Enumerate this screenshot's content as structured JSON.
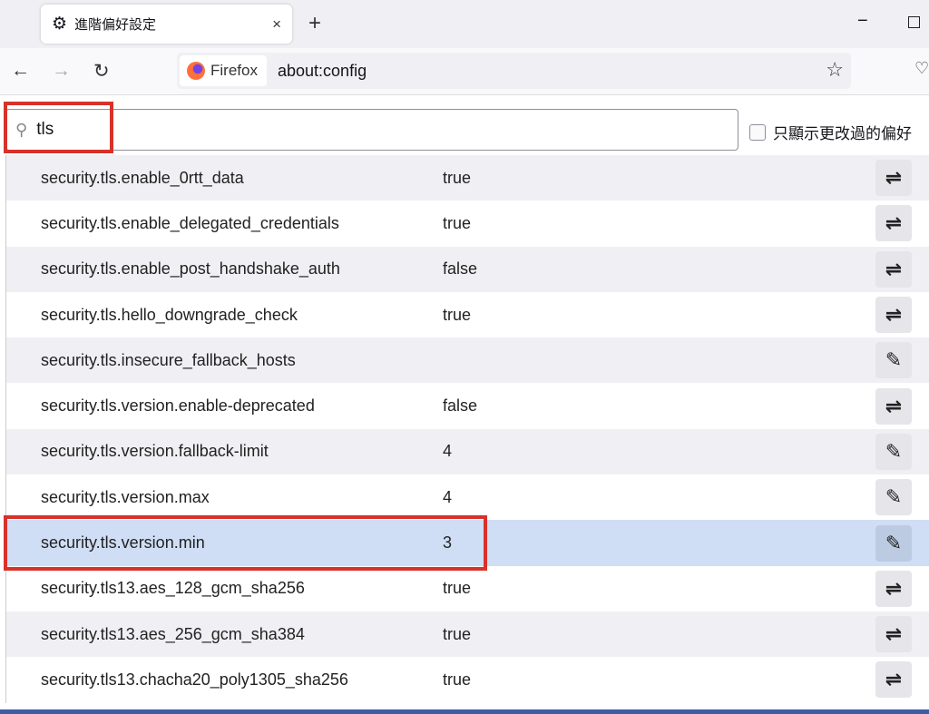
{
  "tab": {
    "title": "進階偏好設定",
    "close": "×",
    "new_tab": "+"
  },
  "window": {
    "minimize": "−"
  },
  "nav": {
    "back": "←",
    "forward": "→",
    "reload": "↻",
    "identity_label": "Firefox",
    "url": "about:config",
    "bookmark": "☆",
    "pocket": "♡"
  },
  "search": {
    "value": "tls",
    "icon": "⚲"
  },
  "filter": {
    "label": "只顯示更改過的偏好"
  },
  "prefs": [
    {
      "name": "security.tls.enable_0rtt_data",
      "value": "true",
      "action": "toggle"
    },
    {
      "name": "security.tls.enable_delegated_credentials",
      "value": "true",
      "action": "toggle"
    },
    {
      "name": "security.tls.enable_post_handshake_auth",
      "value": "false",
      "action": "toggle"
    },
    {
      "name": "security.tls.hello_downgrade_check",
      "value": "true",
      "action": "toggle"
    },
    {
      "name": "security.tls.insecure_fallback_hosts",
      "value": "",
      "action": "edit"
    },
    {
      "name": "security.tls.version.enable-deprecated",
      "value": "false",
      "action": "toggle"
    },
    {
      "name": "security.tls.version.fallback-limit",
      "value": "4",
      "action": "edit"
    },
    {
      "name": "security.tls.version.max",
      "value": "4",
      "action": "edit"
    },
    {
      "name": "security.tls.version.min",
      "value": "3",
      "action": "edit",
      "selected": true
    },
    {
      "name": "security.tls13.aes_128_gcm_sha256",
      "value": "true",
      "action": "toggle"
    },
    {
      "name": "security.tls13.aes_256_gcm_sha384",
      "value": "true",
      "action": "toggle"
    },
    {
      "name": "security.tls13.chacha20_poly1305_sha256",
      "value": "true",
      "action": "toggle"
    }
  ],
  "icons": {
    "toggle": "⇌",
    "edit": "✎"
  },
  "colors": {
    "highlight": "#d8322a",
    "selected_row": "#cfdef5"
  }
}
